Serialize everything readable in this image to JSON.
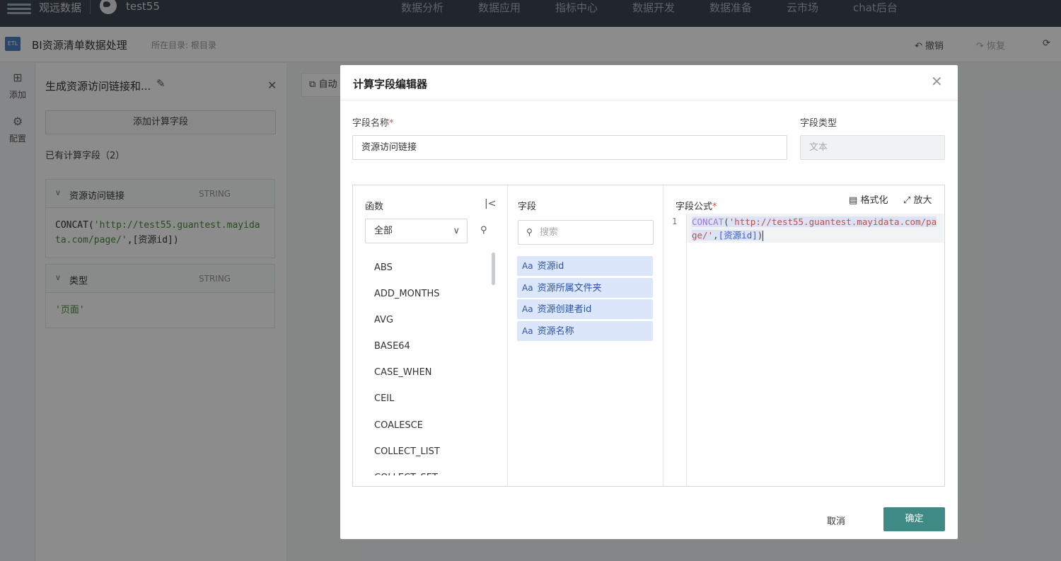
{
  "topnav": {
    "brand": "观远数据",
    "project": "test55",
    "menu": [
      "数据分析",
      "数据应用",
      "指标中心",
      "数据开发",
      "数据准备",
      "云市场",
      "chat后台"
    ]
  },
  "header": {
    "etl_badge": "ETL",
    "title": "BI资源清单数据处理",
    "directory": "所在目录: 根目录",
    "undo": "撤销",
    "redo": "恢复"
  },
  "rail": {
    "add": "添加",
    "config": "配置"
  },
  "panel": {
    "title": "生成资源访问链接和...",
    "add_button": "添加计算字段",
    "existing_label": "已有计算字段（2）",
    "fields": [
      {
        "name": "资源访问链接",
        "type": "STRING",
        "formula_fn": "CONCAT(",
        "formula_str": "'http://test55.guantest.mayidata.com/page/'",
        "formula_rest": ",[资源id])"
      },
      {
        "name": "类型",
        "type": "STRING",
        "formula_str": "'页面'"
      }
    ]
  },
  "auto_button": "自动",
  "modal": {
    "title": "计算字段编辑器",
    "name_label": "字段名称",
    "required_mark": "*",
    "name_value": "资源访问链接",
    "type_label": "字段类型",
    "type_placeholder": "文本",
    "functions": {
      "header": "函数",
      "select_value": "全部",
      "items": [
        "ABS",
        "ADD_MONTHS",
        "AVG",
        "BASE64",
        "CASE_WHEN",
        "CEIL",
        "COALESCE",
        "COLLECT_LIST",
        "COLLECT_SET"
      ]
    },
    "fields": {
      "header": "字段",
      "search_placeholder": "搜索",
      "type_glyph": "Aa",
      "items": [
        "资源id",
        "资源所属文件夹",
        "资源创建者id",
        "资源名称"
      ]
    },
    "formula": {
      "header": "字段公式",
      "format_label": "格式化",
      "zoom_label": "放大",
      "line_number": "1",
      "fn": "CONCAT",
      "open_paren": "(",
      "str": "'http://test55.guantest.mayidata.com/page/'",
      "comma": ",",
      "field": "[资源id]",
      "close_paren": ")"
    },
    "cancel": "取消",
    "confirm": "确定",
    "colors": {
      "primary": "#3f8a84",
      "field_chip": "#dce6fb",
      "required": "#e0524e"
    }
  }
}
